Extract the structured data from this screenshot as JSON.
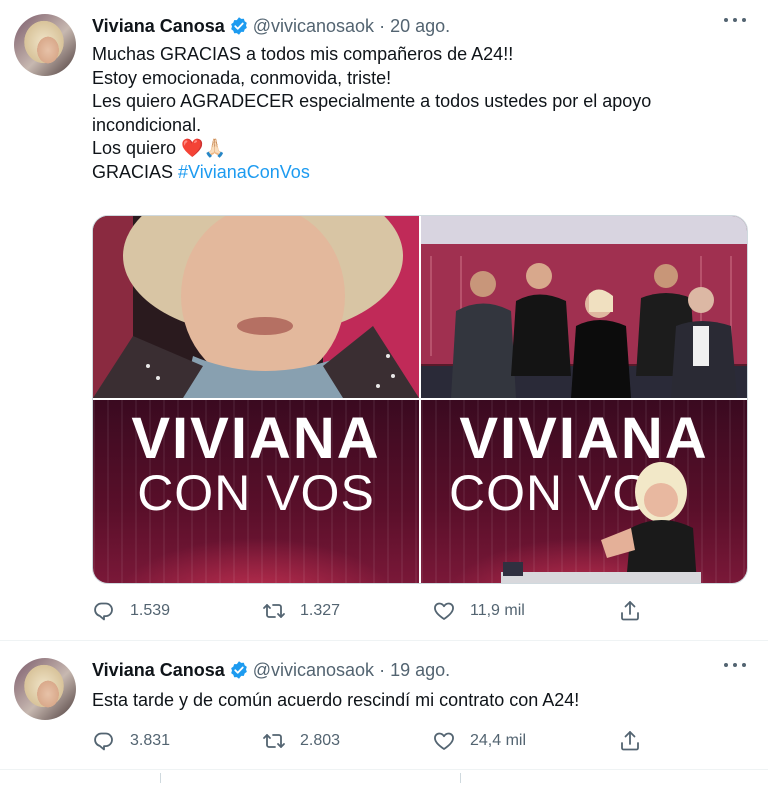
{
  "tweets": [
    {
      "author": {
        "name": "Viviana Canosa",
        "handle": "@vivicanosaok",
        "verified": true
      },
      "date": "20 ago.",
      "lines": [
        "Muchas GRACIAS a todos mis compañeros de A24!!",
        "Estoy emocionada, conmovida, triste!",
        "Les quiero AGRADECER especialmente a todos ustedes por el apoyo",
        "incondicional.",
        "Los quiero ❤️🙏🏻",
        "GRACIAS"
      ],
      "hashtag": "#VivianaConVos",
      "media": {
        "images": [
          {
            "icon": "selfie-photo"
          },
          {
            "icon": "group-photo"
          },
          {
            "logo_line_1": "VIVIANA",
            "logo_line_2": "CON VOS"
          },
          {
            "logo_line_1": "VIVIANA",
            "logo_line_2": "CON VO"
          }
        ]
      },
      "stats": {
        "replies": "1.539",
        "retweets": "1.327",
        "likes": "11,9 mil"
      }
    },
    {
      "author": {
        "name": "Viviana Canosa",
        "handle": "@vivicanosaok",
        "verified": true
      },
      "date": "19 ago.",
      "lines": [
        "Esta tarde y de común acuerdo rescindí mi contrato con A24!"
      ],
      "stats": {
        "replies": "3.831",
        "retweets": "2.803",
        "likes": "24,4 mil"
      }
    }
  ],
  "colors": {
    "accent": "#1d9bf0",
    "muted": "#536471",
    "text": "#0f1419",
    "heart": "#d61f3a"
  }
}
